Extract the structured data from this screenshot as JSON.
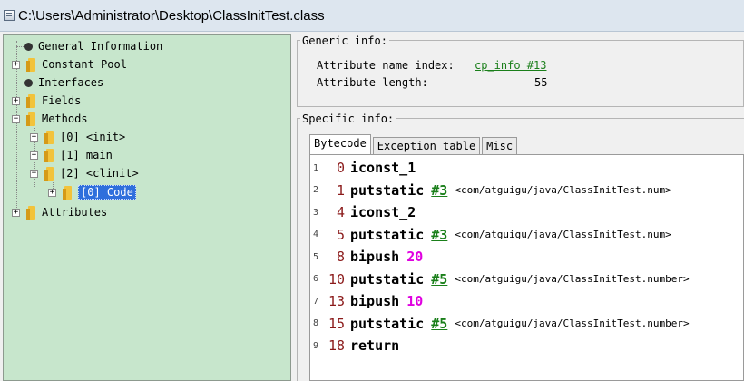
{
  "window": {
    "title": "C:\\Users\\Administrator\\Desktop\\ClassInitTest.class"
  },
  "tree": {
    "general_information": "General Information",
    "constant_pool": "Constant Pool",
    "interfaces": "Interfaces",
    "fields": "Fields",
    "methods": "Methods",
    "method_0": "[0] <init>",
    "method_1": "[1] main",
    "method_2": "[2] <clinit>",
    "method_2_code": "[0] Code",
    "attributes": "Attributes",
    "expander_plus": "+",
    "expander_minus": "−"
  },
  "generic_info": {
    "title": "Generic info:",
    "attr_name_label": "Attribute name index:",
    "attr_name_value": "cp_info #13",
    "attr_length_label": "Attribute length:",
    "attr_length_value": "55"
  },
  "specific_info": {
    "title": "Specific info:",
    "tabs": [
      "Bytecode",
      "Exception table",
      "Misc"
    ]
  },
  "bytecode": [
    {
      "line": "1",
      "offset": "0",
      "op": "iconst_1"
    },
    {
      "line": "2",
      "offset": "1",
      "op": "putstatic",
      "ref": "#3",
      "comment": "<com/atguigu/java/ClassInitTest.num>"
    },
    {
      "line": "3",
      "offset": "4",
      "op": "iconst_2"
    },
    {
      "line": "4",
      "offset": "5",
      "op": "putstatic",
      "ref": "#3",
      "comment": "<com/atguigu/java/ClassInitTest.num>"
    },
    {
      "line": "5",
      "offset": "8",
      "op": "bipush",
      "num": "20"
    },
    {
      "line": "6",
      "offset": "10",
      "op": "putstatic",
      "ref": "#5",
      "comment": "<com/atguigu/java/ClassInitTest.number>"
    },
    {
      "line": "7",
      "offset": "13",
      "op": "bipush",
      "num": "10"
    },
    {
      "line": "8",
      "offset": "15",
      "op": "putstatic",
      "ref": "#5",
      "comment": "<com/atguigu/java/ClassInitTest.number>"
    },
    {
      "line": "9",
      "offset": "18",
      "op": "return"
    }
  ],
  "colors": {
    "tree_background": "#c7e6cc",
    "selection": "#2f6fdc",
    "offset": "#8b1a1a",
    "immediate": "#e000e0",
    "link": "#1a7f1a"
  }
}
